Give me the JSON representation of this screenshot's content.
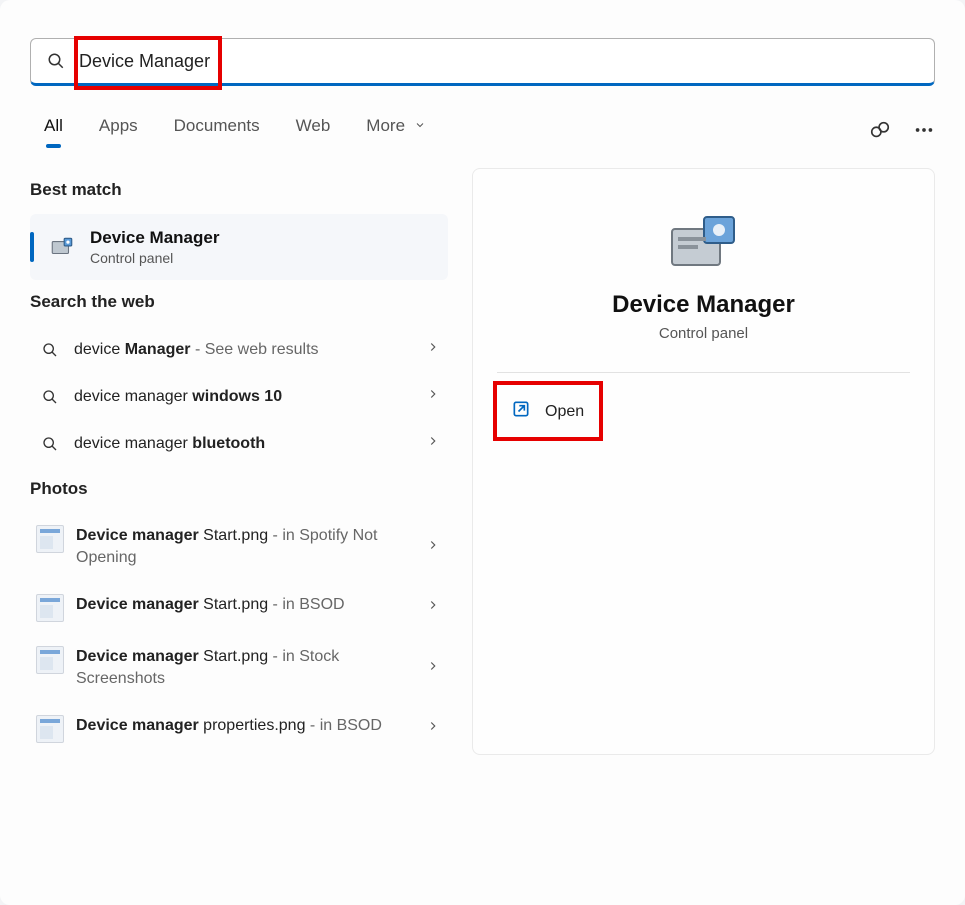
{
  "search": {
    "value": "Device Manager"
  },
  "tabs": {
    "items": [
      "All",
      "Apps",
      "Documents",
      "Web",
      "More"
    ],
    "active": 0
  },
  "sections": {
    "best_match": {
      "title": "Best match",
      "item": {
        "title": "Device Manager",
        "subtitle": "Control panel"
      }
    },
    "web": {
      "title": "Search the web",
      "items": [
        {
          "pre": "device ",
          "bold": "Manager",
          "suf": " - See web results"
        },
        {
          "pre": "device manager ",
          "bold": "windows 10",
          "suf": ""
        },
        {
          "pre": "device manager ",
          "bold": "bluetooth",
          "suf": ""
        }
      ]
    },
    "photos": {
      "title": "Photos",
      "items": [
        {
          "bold": "Device manager",
          "rest": " Start.png",
          "suf": " - in Spotify Not Opening"
        },
        {
          "bold": "Device manager",
          "rest": " Start.png",
          "suf": " - in BSOD"
        },
        {
          "bold": "Device manager",
          "rest": " Start.png",
          "suf": " - in Stock Screenshots"
        },
        {
          "bold": "Device manager",
          "rest": " properties.png",
          "suf": " - in BSOD"
        }
      ]
    }
  },
  "detail": {
    "title": "Device Manager",
    "subtitle": "Control panel",
    "actions": {
      "open": "Open"
    }
  }
}
